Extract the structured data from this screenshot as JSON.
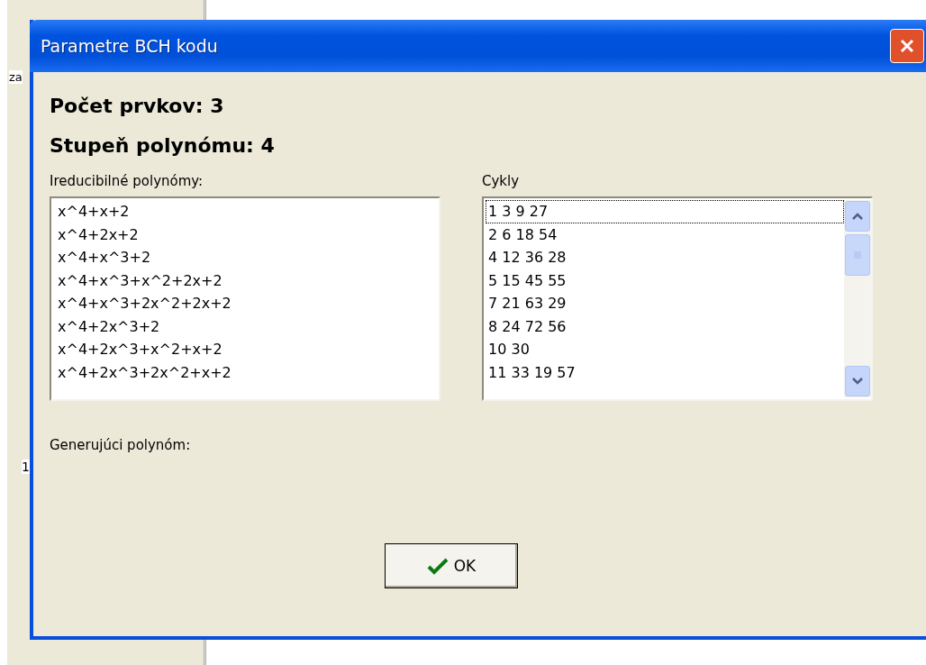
{
  "background": {
    "texts": [
      "za",
      "1"
    ]
  },
  "window": {
    "title": "Parametre BCH kodu"
  },
  "summary": [
    "Počet prvkov: 3",
    "Stupeň polynómu: 4"
  ],
  "polynomials": {
    "label": "Ireducibilné polynómy:",
    "items": [
      {
        "text": "x^4+x+2",
        "selected": false
      },
      {
        "text": "x^4+2x+2",
        "selected": false
      },
      {
        "text": "x^4+x^3+2",
        "selected": false
      },
      {
        "text": "x^4+x^3+x^2+2x+2",
        "selected": false
      },
      {
        "text": "x^4+x^3+2x^2+2x+2",
        "selected": false
      },
      {
        "text": "x^4+2x^3+2",
        "selected": false
      },
      {
        "text": "x^4+2x^3+x^2+x+2",
        "selected": false
      },
      {
        "text": "x^4+2x^3+2x^2+x+2",
        "selected": false
      }
    ]
  },
  "cycles": {
    "label": "Cykly",
    "items": [
      {
        "text": "1 3 9 27",
        "selected": true
      },
      {
        "text": "2 6 18 54",
        "selected": false
      },
      {
        "text": "4 12 36 28",
        "selected": false
      },
      {
        "text": "5 15 45 55",
        "selected": false
      },
      {
        "text": "7 21 63 29",
        "selected": false
      },
      {
        "text": "8 24 72 56",
        "selected": false
      },
      {
        "text": "10 30",
        "selected": false
      },
      {
        "text": "11 33 19 57",
        "selected": false
      }
    ]
  },
  "generator": {
    "label": "Generujúci polynóm:"
  },
  "buttons": [
    {
      "label": "OK"
    }
  ]
}
